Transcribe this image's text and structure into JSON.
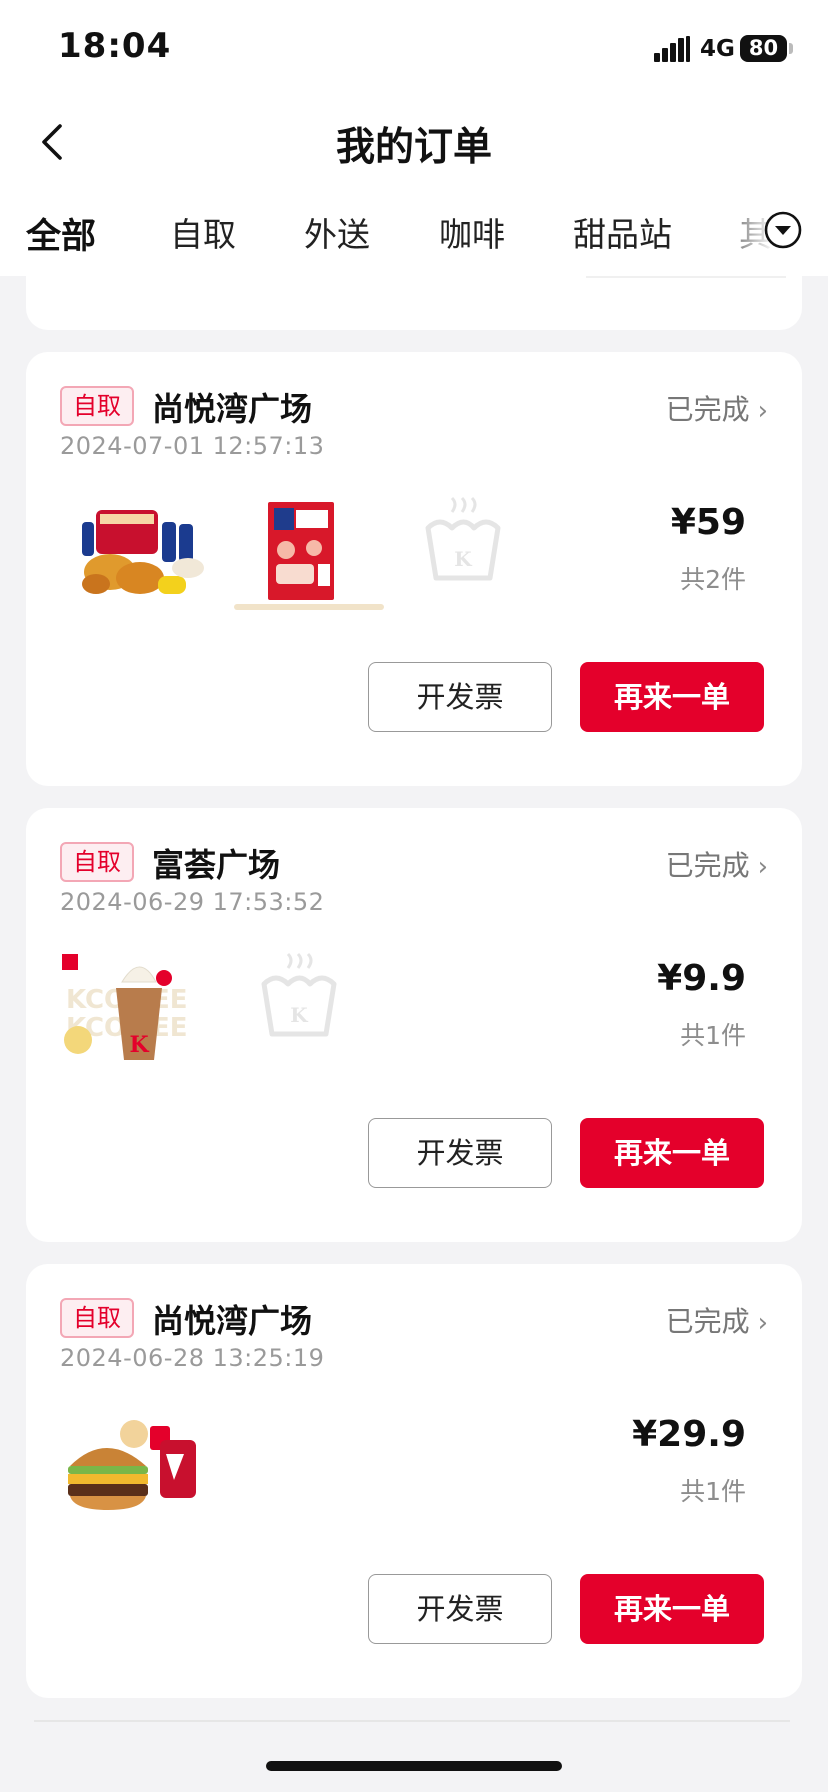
{
  "status_bar": {
    "time": "18:04",
    "network": "4G",
    "battery": "80"
  },
  "nav": {
    "title": "我的订单",
    "back_icon": "chevron-left-icon"
  },
  "tabs": {
    "items": [
      {
        "label": "全部",
        "active": true
      },
      {
        "label": "自取"
      },
      {
        "label": "外送"
      },
      {
        "label": "咖啡"
      },
      {
        "label": "甜品站"
      },
      {
        "label": "其"
      }
    ],
    "expand_icon": "chevron-down-circle-icon"
  },
  "accent_color": "#e4002b",
  "orders": [
    {
      "tag": "自取",
      "store": "尚悦湾广场",
      "status": "已完成",
      "datetime": "2024-07-01 12:57:13",
      "price": "¥59",
      "count": "共2件",
      "items": [
        "fried-chicken-bucket-image",
        "promo-card-image",
        "kfc-bucket-placeholder-icon"
      ],
      "invoice_label": "开发票",
      "reorder_label": "再来一单"
    },
    {
      "tag": "自取",
      "store": "富荟广场",
      "status": "已完成",
      "datetime": "2024-06-29 17:53:52",
      "price": "¥9.9",
      "count": "共1件",
      "items": [
        "kcoffee-sundae-image",
        "kfc-bucket-placeholder-icon"
      ],
      "invoice_label": "开发票",
      "reorder_label": "再来一单"
    },
    {
      "tag": "自取",
      "store": "尚悦湾广场",
      "status": "已完成",
      "datetime": "2024-06-28 13:25:19",
      "price": "¥29.9",
      "count": "共1件",
      "items": [
        "burger-combo-image"
      ],
      "invoice_label": "开发票",
      "reorder_label": "再来一单"
    }
  ]
}
